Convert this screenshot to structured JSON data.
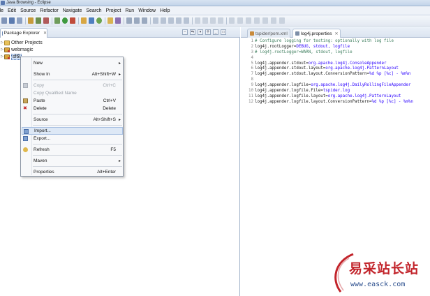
{
  "window": {
    "title": "Java Browsing - Eclipse"
  },
  "menubar": [
    "ile",
    "Edit",
    "Source",
    "Refactor",
    "Navigate",
    "Search",
    "Project",
    "Run",
    "Window",
    "Help"
  ],
  "package_explorer": {
    "tab_label": "Package Explorer",
    "tab_close": "✕",
    "tree": [
      {
        "label": "Other Projects",
        "kind": "folder"
      },
      {
        "label": "webmagic",
        "kind": "project"
      },
      {
        "label": "sf6l",
        "kind": "project"
      }
    ]
  },
  "context_menu": {
    "items": [
      {
        "label": "New",
        "shortcut": "",
        "submenu": true,
        "disabled": false
      },
      {
        "label": "Show In",
        "shortcut": "Alt+Shift+W",
        "submenu": true,
        "disabled": false
      },
      {
        "label": "Copy",
        "shortcut": "Ctrl+C",
        "submenu": false,
        "disabled": true
      },
      {
        "label": "Copy Qualified Name",
        "shortcut": "",
        "submenu": false,
        "disabled": true
      },
      {
        "label": "Paste",
        "shortcut": "Ctrl+V",
        "submenu": false,
        "disabled": false
      },
      {
        "label": "Delete",
        "shortcut": "Delete",
        "submenu": false,
        "disabled": false
      },
      {
        "label": "Source",
        "shortcut": "Alt+Shift+S",
        "submenu": true,
        "disabled": false
      },
      {
        "label": "Import...",
        "shortcut": "",
        "submenu": false,
        "disabled": false,
        "highlighted": true
      },
      {
        "label": "Export...",
        "shortcut": "",
        "submenu": false,
        "disabled": false
      },
      {
        "label": "Refresh",
        "shortcut": "F5",
        "submenu": false,
        "disabled": false
      },
      {
        "label": "Maven",
        "shortcut": "",
        "submenu": true,
        "disabled": false
      },
      {
        "label": "Properties",
        "shortcut": "Alt+Enter",
        "submenu": false,
        "disabled": false
      }
    ]
  },
  "editor": {
    "tabs": [
      {
        "label": "tspider/pom.xml",
        "active": false
      },
      {
        "label": "log4j.properties",
        "active": true
      }
    ],
    "lines": [
      {
        "n": "1",
        "pre": "# Configure logging for testing: optionally with log file",
        "val": "",
        "post": "",
        "comment": true
      },
      {
        "n": "2",
        "pre": "log4j.rootLogger=",
        "val": "DEBUG, stdout, logfile",
        "post": "",
        "comment": false
      },
      {
        "n": "3",
        "pre": "# log4j.rootLogger=WARN, stdout, logfile",
        "val": "",
        "post": "",
        "comment": true
      },
      {
        "n": "4",
        "pre": "",
        "val": "",
        "post": "",
        "comment": false
      },
      {
        "n": "5",
        "pre": "log4j.appender.stdout=",
        "val": "org.apache.log4j.ConsoleAppender",
        "post": "",
        "comment": false
      },
      {
        "n": "6",
        "pre": "log4j.appender.stdout.layout=",
        "val": "org.apache.log4j.PatternLayout",
        "post": "",
        "comment": false
      },
      {
        "n": "7",
        "pre": "log4j.appender.stdout.layout.ConversionPattern=",
        "val": "%d %p [%c] - %m%n",
        "post": "",
        "comment": false
      },
      {
        "n": "8",
        "pre": "",
        "val": "",
        "post": "",
        "comment": false
      },
      {
        "n": "9",
        "pre": "log4j.appender.logfile=",
        "val": "org.apache.log4j.DailyRollingFileAppender",
        "post": "",
        "comment": false
      },
      {
        "n": "10",
        "pre": "log4j.appender.logfile.File=",
        "val": "tspider.log",
        "post": "",
        "comment": false
      },
      {
        "n": "11",
        "pre": "log4j.appender.logfile.layout=",
        "val": "org.apache.log4j.PatternLayout",
        "post": "",
        "comment": false
      },
      {
        "n": "12",
        "pre": "log4j.appender.logfile.layout.ConversionPattern=",
        "val": "%d %p [%c] - %m%n",
        "post": "",
        "comment": false
      }
    ]
  },
  "watermark": {
    "text": "易采站长站",
    "url": "www.easck.com"
  },
  "colors": {
    "comment": "#3f7f5f",
    "value": "#2a00ff",
    "watermark_red": "#c2242b",
    "watermark_blue": "#2c4f8e"
  }
}
